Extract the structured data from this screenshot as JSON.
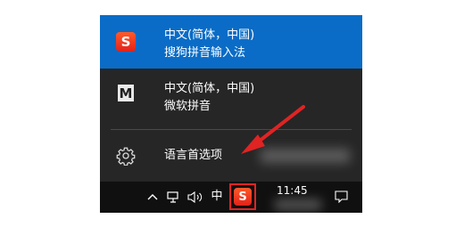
{
  "language_menu": {
    "items": [
      {
        "line1": "中文(简体，中国)",
        "line2": "搜狗拼音输入法",
        "icon": "sogou-logo-icon",
        "icon_text": "S",
        "selected": true
      },
      {
        "line1": "中文(简体，中国)",
        "line2": "微软拼音",
        "icon": "microsoft-ime-icon",
        "icon_text": "M",
        "selected": false
      }
    ],
    "preferences_label": "语言首选项",
    "preferences_icon": "gear-icon"
  },
  "taskbar": {
    "input_mode_indicator": "中",
    "ime_tray_icon_text": "S",
    "time": "11:45",
    "icons": [
      "chevron-up-icon",
      "network-icon",
      "volume-icon",
      "notification-icon"
    ]
  },
  "colors": {
    "selected_bg": "#0a6cc6",
    "menu_bg": "#262626",
    "taskbar_bg": "#101010",
    "highlight_box": "#e02323",
    "annotation_arrow": "#e02323"
  }
}
